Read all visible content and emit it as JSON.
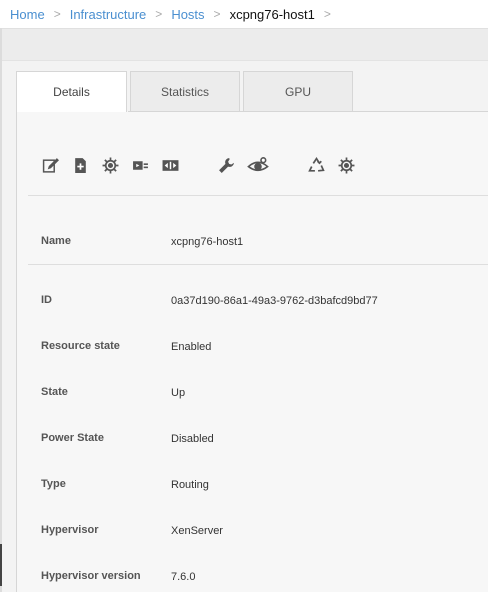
{
  "breadcrumb": {
    "items": [
      "Home",
      "Infrastructure",
      "Hosts"
    ],
    "current": "xcpng76-host1",
    "separator": ">"
  },
  "tabs": [
    {
      "label": "Details",
      "active": true
    },
    {
      "label": "Statistics",
      "active": false
    },
    {
      "label": "GPU",
      "active": false
    }
  ],
  "actions": [
    "edit-icon",
    "add-document-icon",
    "settings-gear-icon",
    "migrate-icon",
    "toggle-icon",
    "wrench-icon",
    "observe-eye-icon",
    "recycle-icon",
    "gear-icon"
  ],
  "details": [
    {
      "label": "Name",
      "value": "xcpng76-host1"
    },
    {
      "label": "ID",
      "value": "0a37d190-86a1-49a3-9762-d3bafcd9bd77"
    },
    {
      "label": "Resource state",
      "value": "Enabled"
    },
    {
      "label": "State",
      "value": "Up"
    },
    {
      "label": "Power State",
      "value": "Disabled"
    },
    {
      "label": "Type",
      "value": "Routing"
    },
    {
      "label": "Hypervisor",
      "value": "XenServer"
    },
    {
      "label": "Hypervisor version",
      "value": "7.6.0"
    }
  ],
  "colors": {
    "link": "#4a8fd0",
    "panel_bg": "#f7f7f7",
    "tab_border": "#d6d6d6"
  }
}
